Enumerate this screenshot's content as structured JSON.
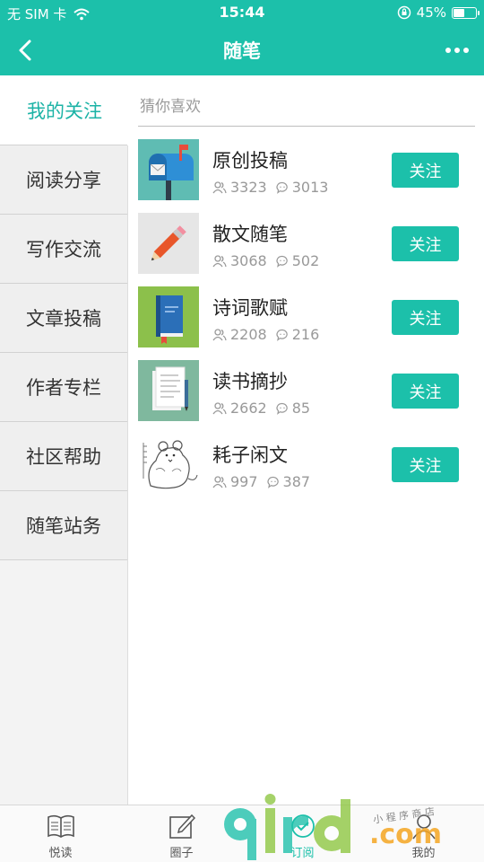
{
  "status_bar": {
    "carrier": "无 SIM 卡",
    "time": "15:44",
    "battery": "45%",
    "battery_level": 0.45
  },
  "nav": {
    "title": "随笔",
    "back_icon": "chevron-left-icon",
    "more_icon": "more-dots-icon"
  },
  "sidebar": {
    "items": [
      {
        "label": "我的关注"
      },
      {
        "label": "阅读分享"
      },
      {
        "label": "写作交流"
      },
      {
        "label": "文章投稿"
      },
      {
        "label": "作者专栏"
      },
      {
        "label": "社区帮助"
      },
      {
        "label": "随笔站务"
      }
    ]
  },
  "search": {
    "placeholder": "猜你喜欢"
  },
  "list": {
    "follow_label": "关注",
    "items": [
      {
        "name": "原创投稿",
        "members": "3323",
        "posts": "3013",
        "thumb": "mailbox-icon"
      },
      {
        "name": "散文随笔",
        "members": "3068",
        "posts": "502",
        "thumb": "pencil-icon"
      },
      {
        "name": "诗词歌赋",
        "members": "2208",
        "posts": "216",
        "thumb": "book-icon"
      },
      {
        "name": "读书摘抄",
        "members": "2662",
        "posts": "85",
        "thumb": "document-icon"
      },
      {
        "name": "耗子闲文",
        "members": "997",
        "posts": "387",
        "thumb": "mouse-sketch-icon"
      }
    ]
  },
  "tabs": [
    {
      "label": "悦读",
      "icon": "open-book-icon"
    },
    {
      "label": "圈子",
      "icon": "edit-square-icon"
    },
    {
      "label": "订阅",
      "icon": "subscribe-icon"
    },
    {
      "label": "我的",
      "icon": "user-icon"
    }
  ],
  "watermark": {
    "brand": "9ird.com",
    "tagline": "小 程 序 商 店"
  },
  "colors": {
    "accent": "#1cc0aa",
    "active_side": "#1cb3a6"
  }
}
